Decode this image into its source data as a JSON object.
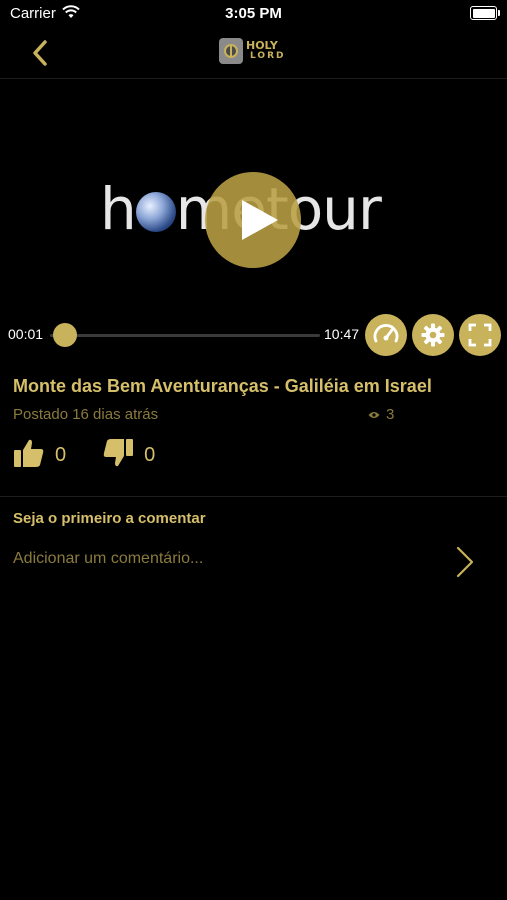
{
  "status_bar": {
    "carrier": "Carrier",
    "time": "3:05 PM"
  },
  "nav": {
    "logo_line1": "HOLY",
    "logo_line2": "LORD"
  },
  "video": {
    "overlay_text_left": "h",
    "overlay_text_right": "me",
    "overlay_text_end": "tour",
    "current_time": "00:01",
    "duration": "10:47",
    "progress_fraction": 0.02
  },
  "post": {
    "title": "Monte das Bem Aventuranças - Galiléia em Israel",
    "posted": "Postado 16 dias atrás",
    "views": "3",
    "likes": "0",
    "dislikes": "0"
  },
  "comments": {
    "header": "Seja o primeiro a comentar",
    "placeholder": "Adicionar um comentário..."
  },
  "colors": {
    "accent": "#c8b25b",
    "text_gold": "#d6bf6a",
    "muted_gold": "#8a7a3d",
    "background": "#000000"
  }
}
